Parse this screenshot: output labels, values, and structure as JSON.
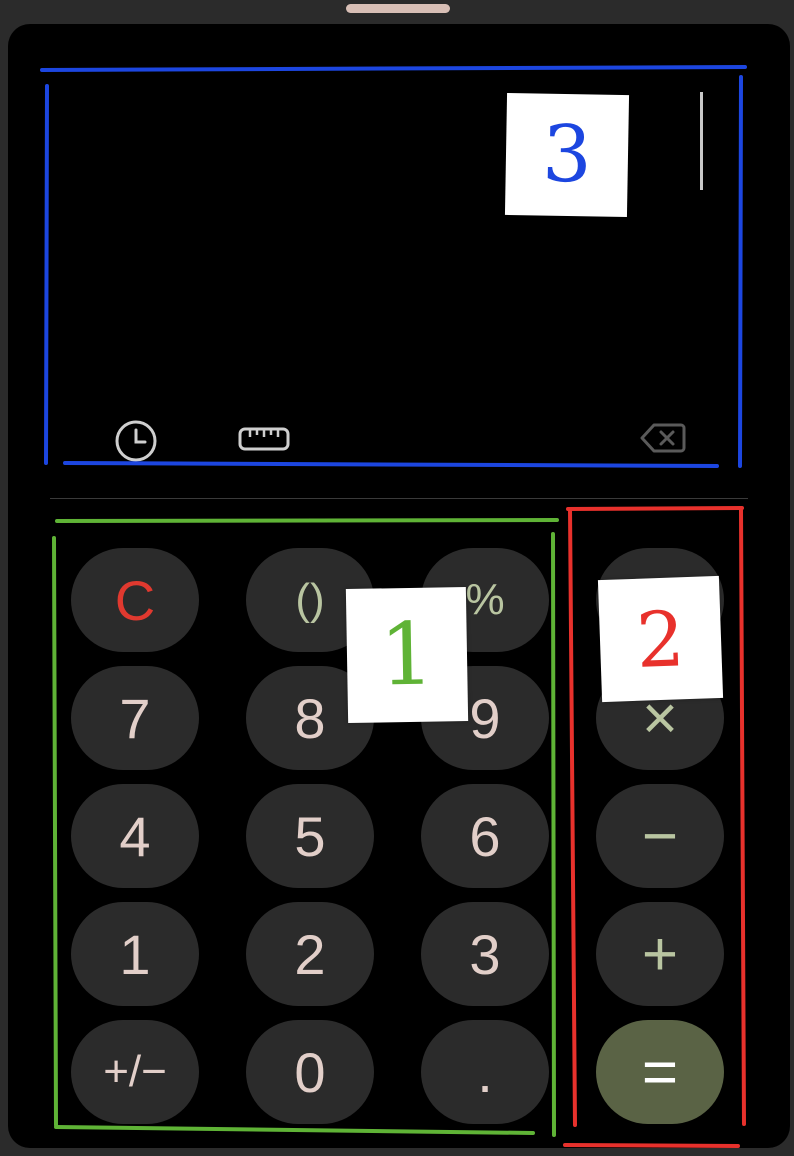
{
  "display": {
    "expression": "",
    "history_icon": "clock-icon",
    "converter_icon": "ruler-icon",
    "backspace_icon": "backspace-icon"
  },
  "keypad": {
    "rows": [
      [
        "C",
        "()",
        "%"
      ],
      [
        "7",
        "8",
        "9"
      ],
      [
        "4",
        "5",
        "6"
      ],
      [
        "1",
        "2",
        "3"
      ],
      [
        "+/−",
        "0",
        "."
      ]
    ]
  },
  "operators": [
    "÷",
    "×",
    "−",
    "+",
    "="
  ],
  "annotations": {
    "label_1": "1",
    "label_2": "2",
    "label_3": "3",
    "color_1": "#5fb336",
    "color_2": "#e8312c",
    "color_3": "#1c46e0"
  },
  "colors": {
    "background": "#000000",
    "key_bg": "#2b2b2b",
    "digit_text": "#e2cfc9",
    "clear_text": "#e0392f",
    "operator_text": "#b9c5a1",
    "equals_bg": "#5a6345"
  }
}
